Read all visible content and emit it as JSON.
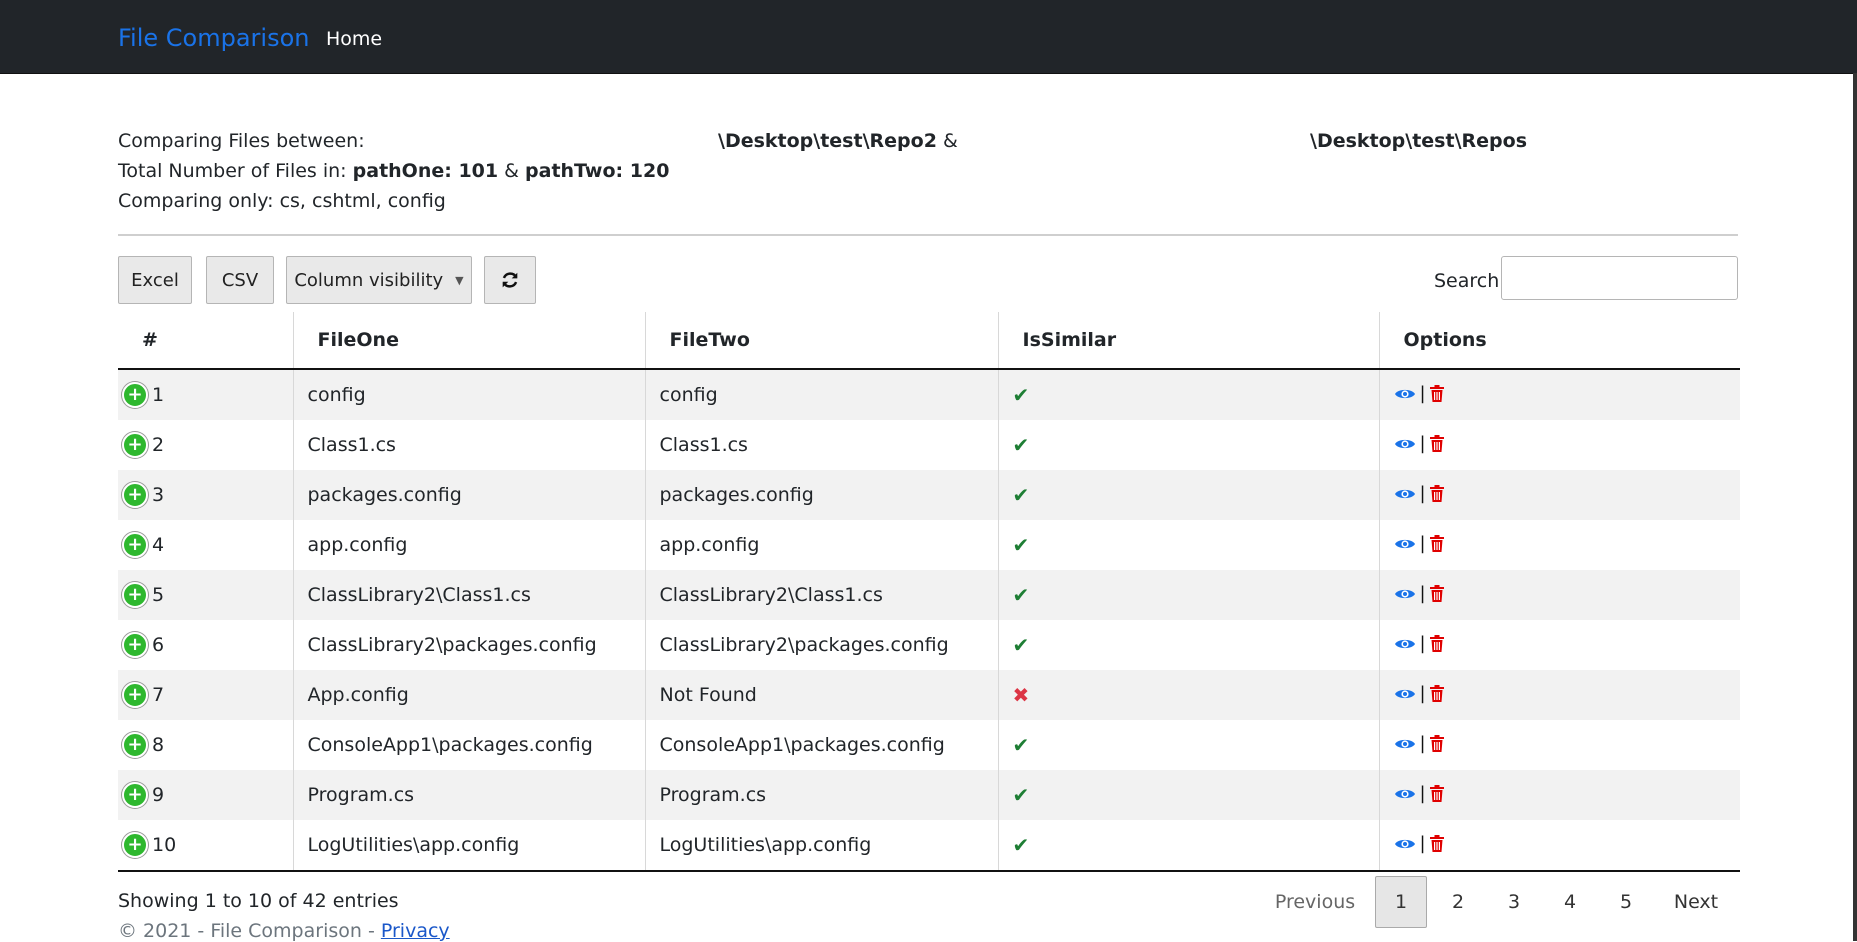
{
  "nav": {
    "brand": "File Comparison",
    "home": "Home"
  },
  "info": {
    "comparing_label": "Comparing Files between:",
    "path_one": "\\Desktop\\test\\Repo2",
    "amp": "&",
    "path_two": "\\Desktop\\test\\Repos",
    "total_prefix": "Total Number of Files in:",
    "path_one_count": "pathOne: 101",
    "path_two_count": "pathTwo: 120",
    "comparing_only": "Comparing only: cs, cshtml, config"
  },
  "toolbar": {
    "excel": "Excel",
    "csv": "CSV",
    "column_visibility": "Column visibility",
    "search_label": "Search:",
    "search_value": ""
  },
  "table": {
    "headers": [
      "#",
      "FileOne",
      "FileTwo",
      "IsSimilar",
      "Options"
    ],
    "rows": [
      {
        "num": "1",
        "file_one": "config",
        "file_two": "config",
        "similar": true
      },
      {
        "num": "2",
        "file_one": "Class1.cs",
        "file_two": "Class1.cs",
        "similar": true
      },
      {
        "num": "3",
        "file_one": "packages.config",
        "file_two": "packages.config",
        "similar": true
      },
      {
        "num": "4",
        "file_one": "app.config",
        "file_two": "app.config",
        "similar": true
      },
      {
        "num": "5",
        "file_one": "ClassLibrary2\\Class1.cs",
        "file_two": "ClassLibrary2\\Class1.cs",
        "similar": true
      },
      {
        "num": "6",
        "file_one": "ClassLibrary2\\packages.config",
        "file_two": "ClassLibrary2\\packages.config",
        "similar": true
      },
      {
        "num": "7",
        "file_one": "App.config",
        "file_two": "Not Found",
        "similar": false
      },
      {
        "num": "8",
        "file_one": "ConsoleApp1\\packages.config",
        "file_two": "ConsoleApp1\\packages.config",
        "similar": true
      },
      {
        "num": "9",
        "file_one": "Program.cs",
        "file_two": "Program.cs",
        "similar": true
      },
      {
        "num": "10",
        "file_one": "LogUtilities\\app.config",
        "file_two": "LogUtilities\\app.config",
        "similar": true
      }
    ]
  },
  "paging": {
    "showing": "Showing 1 to 10 of 42 entries",
    "previous": "Previous",
    "pages": [
      "1",
      "2",
      "3",
      "4",
      "5"
    ],
    "next": "Next"
  },
  "footer": {
    "text": "© 2021 - File Comparison - ",
    "privacy": "Privacy"
  },
  "colors": {
    "brand": "#1a73e8",
    "check": "#1e7e34",
    "cross": "#dc3545",
    "view": "#1a73e8",
    "delete": "#e00000",
    "expand": "#2eb82e"
  }
}
